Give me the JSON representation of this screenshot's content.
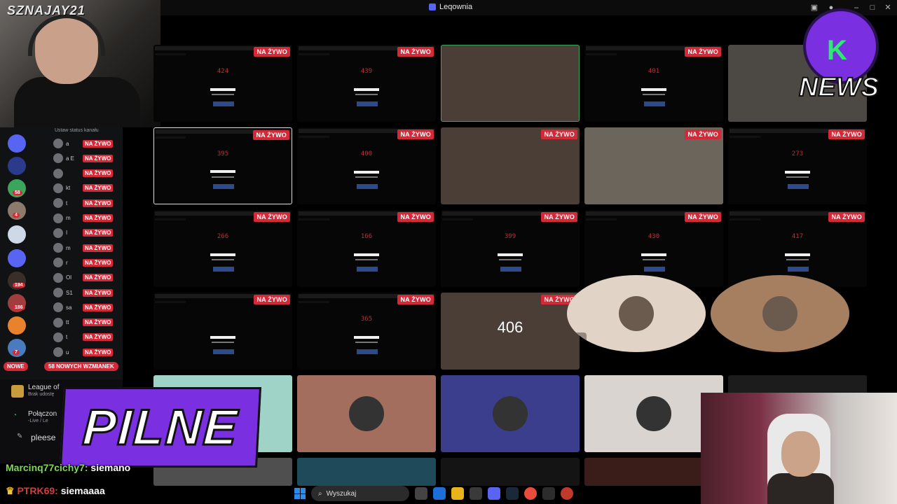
{
  "window": {
    "title": "Leqownia"
  },
  "streamer_tag": "SZNAJAY21",
  "news_logo": {
    "label": "NEWS",
    "mark": "K"
  },
  "banner": {
    "text": "PILNE"
  },
  "live_label": "NA ŻYWO",
  "grid": {
    "tiles": [
      {
        "type": "screen",
        "live": true,
        "num": "424"
      },
      {
        "type": "screen",
        "live": true,
        "num": "439"
      },
      {
        "type": "cam",
        "live": false,
        "outline": true
      },
      {
        "type": "screen",
        "live": true,
        "num": "401"
      },
      {
        "type": "cam",
        "live": false
      },
      {
        "type": "screen",
        "live": true,
        "num": "395",
        "white_outline": true
      },
      {
        "type": "screen",
        "live": true,
        "num": "400"
      },
      {
        "type": "cam",
        "live": true
      },
      {
        "type": "cam",
        "live": true
      },
      {
        "type": "screen",
        "live": true,
        "num": "273"
      },
      {
        "type": "screen",
        "live": true,
        "num": "266"
      },
      {
        "type": "screen",
        "live": true,
        "num": "166"
      },
      {
        "type": "screen",
        "live": true,
        "num": "399"
      },
      {
        "type": "screen",
        "live": true,
        "num": "430"
      },
      {
        "type": "screen",
        "live": true,
        "num": "417"
      },
      {
        "type": "screen",
        "live": true,
        "num": ""
      },
      {
        "type": "screen",
        "live": true,
        "num": "365"
      },
      {
        "type": "cam",
        "live": true,
        "count": "406"
      },
      {
        "type": "avatar",
        "live": false,
        "muted": true
      },
      {
        "type": "avatar",
        "live": false
      }
    ]
  },
  "sidebar": {
    "status_hint": "Ustaw status kanału",
    "members": [
      {
        "name": "a"
      },
      {
        "name": "a E"
      },
      {
        "name": ""
      },
      {
        "name": "kt"
      },
      {
        "name": "t"
      },
      {
        "name": "m"
      },
      {
        "name": "I"
      },
      {
        "name": "m"
      },
      {
        "name": "r"
      },
      {
        "name": "Ol"
      },
      {
        "name": "S1"
      },
      {
        "name": "sa"
      },
      {
        "name": "tt"
      },
      {
        "name": "t"
      },
      {
        "name": "u"
      }
    ],
    "guild_badges": [
      "58",
      "4",
      "194",
      "186",
      "7"
    ],
    "new_label": "NOWE",
    "mentions_label": "58 NOWYCH WZMIANEK",
    "activity": {
      "title": "League of",
      "subtitle": "Brak udostę"
    },
    "voice": {
      "title": "Połączon",
      "subtitle": "-Live / Le"
    },
    "partial_text": "pleese"
  },
  "chat": [
    {
      "user": "Marcinq77cichy7",
      "message": "siemano"
    },
    {
      "user": "PTRK69",
      "message": "siemaaaa"
    }
  ],
  "taskbar": {
    "search_placeholder": "Wyszukaj"
  }
}
